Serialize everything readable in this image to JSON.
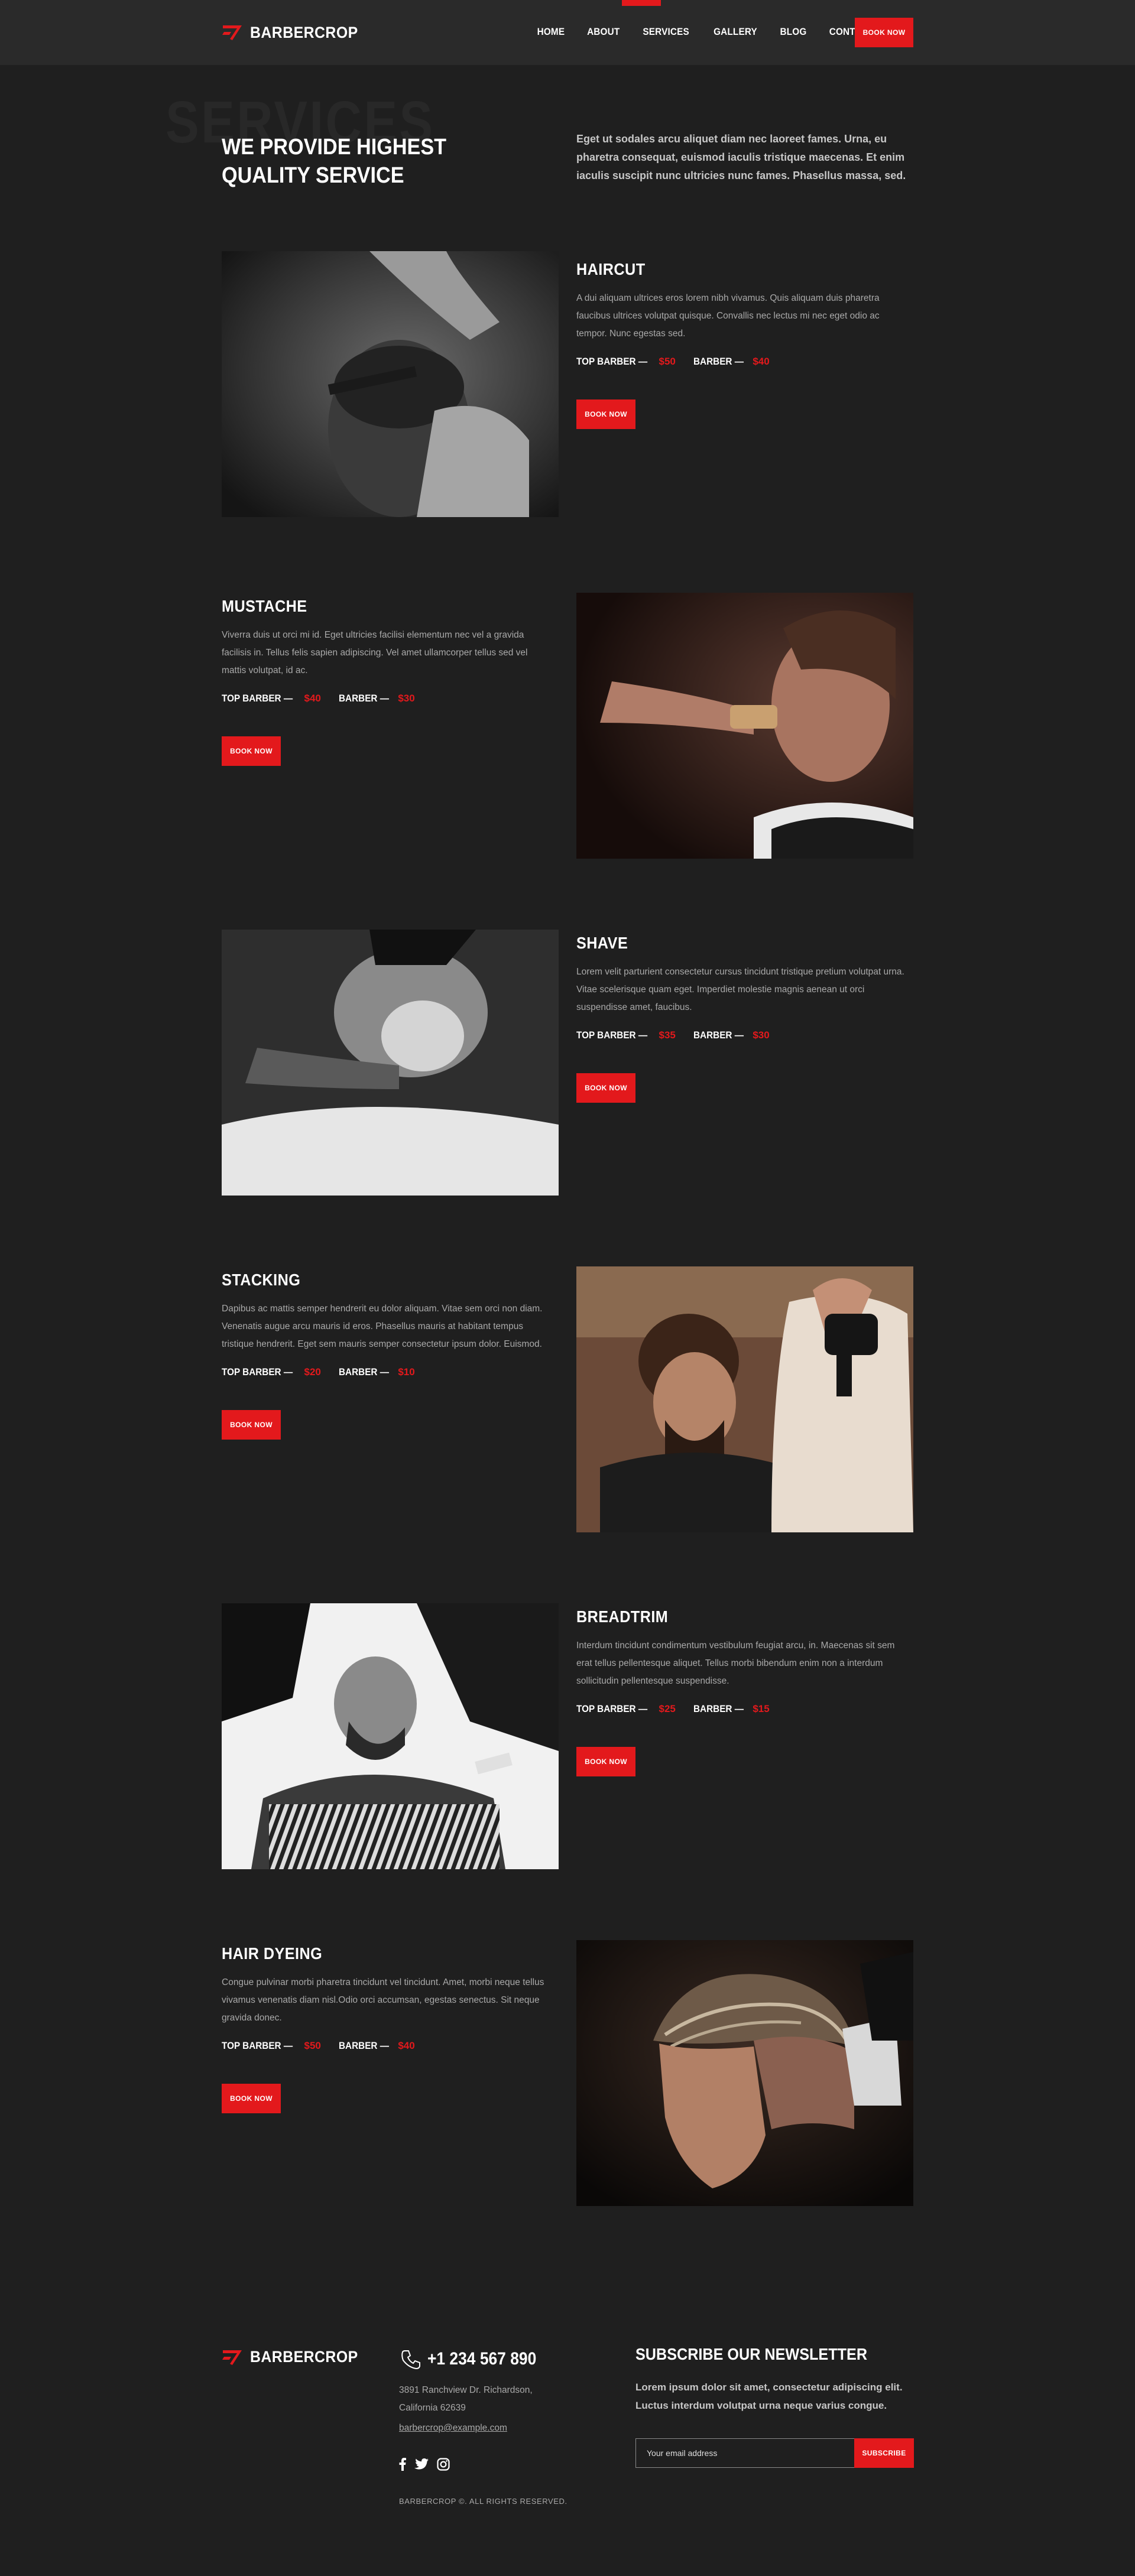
{
  "brand": {
    "name": "BARBERCROP",
    "accent": "#e3191c"
  },
  "nav": {
    "items": [
      {
        "label": "HOME"
      },
      {
        "label": "ABOUT"
      },
      {
        "label": "SERVICES",
        "active": true
      },
      {
        "label": "GALLERY"
      },
      {
        "label": "BLOG"
      },
      {
        "label": "CONTACTS"
      }
    ],
    "book_label": "BOOK NOW"
  },
  "intro": {
    "bg_word": "SERVICES",
    "title": "WE PROVIDE HIGHEST QUALITY SERVICE",
    "text": "Eget ut sodales arcu aliquet diam nec laoreet fames. Urna, eu pharetra consequat, euismod iaculis tristique maecenas. Et enim iaculis suscipit nunc ultricies nunc fames. Phasellus massa, sed."
  },
  "services": [
    {
      "title": "HAIRCUT",
      "desc": "A dui aliquam ultrices eros lorem nibh vivamus. Quis aliquam duis pharetra faucibus ultrices volutpat quisque. Convallis nec lectus mi nec eget odio ac tempor. Nunc egestas sed.",
      "prices": [
        {
          "label": "TOP BARBER —",
          "value": "$50"
        },
        {
          "label": "BARBER —",
          "value": "$40"
        }
      ],
      "book_label": "BOOK NOW",
      "image": "haircut-photo"
    },
    {
      "title": "MUSTACHE",
      "desc": "Viverra duis ut orci mi id. Eget ultricies facilisi elementum nec vel a gravida facilisis in. Tellus felis sapien adipiscing. Vel amet ullamcorper tellus sed vel mattis volutpat, id ac.",
      "prices": [
        {
          "label": "TOP BARBER —",
          "value": "$40"
        },
        {
          "label": "BARBER —",
          "value": "$30"
        }
      ],
      "book_label": "BOOK NOW",
      "image": "mustache-photo"
    },
    {
      "title": "SHAVE",
      "desc": "Lorem velit parturient consectetur cursus tincidunt tristique pretium volutpat urna. Vitae scelerisque quam eget. Imperdiet molestie magnis aenean ut orci suspendisse amet, faucibus.",
      "prices": [
        {
          "label": "TOP BARBER —",
          "value": "$35"
        },
        {
          "label": "BARBER —",
          "value": "$30"
        }
      ],
      "book_label": "BOOK NOW",
      "image": "shave-photo"
    },
    {
      "title": "STACKING",
      "desc": "Dapibus ac mattis semper hendrerit eu dolor aliquam. Vitae sem orci non diam. Venenatis augue arcu mauris id eros. Phasellus mauris at habitant tempus tristique hendrerit. Eget sem mauris semper consectetur ipsum dolor. Euismod.",
      "prices": [
        {
          "label": "TOP BARBER —",
          "value": "$20"
        },
        {
          "label": "BARBER —",
          "value": "$10"
        }
      ],
      "book_label": "BOOK NOW",
      "image": "stacking-photo"
    },
    {
      "title": "BREADTRIM",
      "desc": "Interdum tincidunt condimentum vestibulum feugiat arcu, in. Maecenas sit sem erat tellus pellentesque aliquet. Tellus morbi bibendum enim non a interdum sollicitudin pellentesque suspendisse.",
      "prices": [
        {
          "label": "TOP BARBER —",
          "value": "$25"
        },
        {
          "label": "BARBER —",
          "value": "$15"
        }
      ],
      "book_label": "BOOK NOW",
      "image": "beardtrim-photo"
    },
    {
      "title": "HAIR DYEING",
      "desc": "Congue pulvinar morbi pharetra tincidunt vel tincidunt. Amet, morbi neque tellus vivamus venenatis diam nisl.Odio orci accumsan, egestas senectus. Sit neque gravida donec.",
      "prices": [
        {
          "label": "TOP BARBER —",
          "value": "$50"
        },
        {
          "label": "BARBER —",
          "value": "$40"
        }
      ],
      "book_label": "BOOK NOW",
      "image": "hairdye-photo"
    }
  ],
  "footer": {
    "phone": "+1 234 567 890",
    "address": "3891 Ranchview Dr. Richardson, California 62639",
    "email": "barbercrop@example.com",
    "social": [
      "facebook-icon",
      "twitter-icon",
      "instagram-icon"
    ],
    "copyright": "BARBERCROP ©. ALL RIGHTS RESERVED.",
    "newsletter_title": "SUBSCRIBE OUR NEWSLETTER",
    "newsletter_text": "Lorem ipsum dolor sit amet, consectetur adipiscing elit. Luctus interdum volutpat urna neque varius congue.",
    "email_placeholder": "Your email address",
    "subscribe_label": "SUBSCRIBE"
  }
}
